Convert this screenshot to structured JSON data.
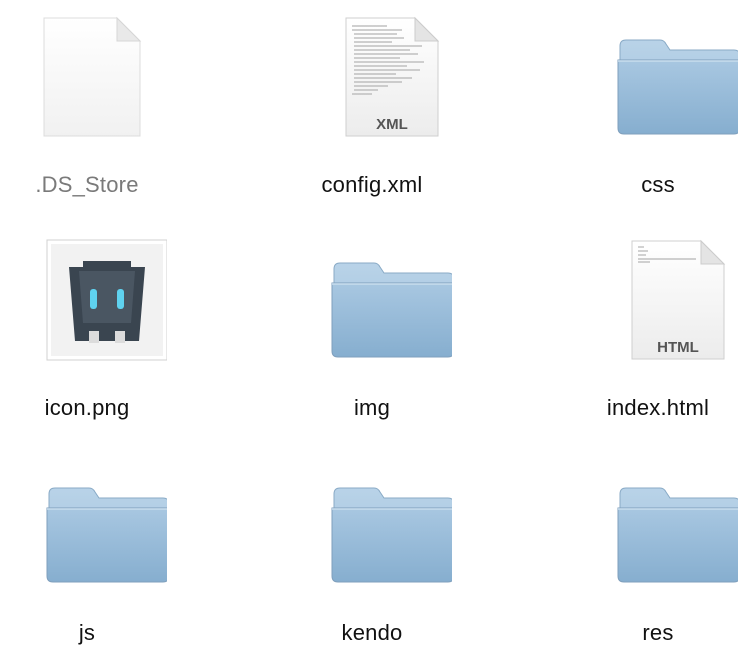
{
  "items": [
    {
      "name": ".DS_Store",
      "kind": "blank-document-icon"
    },
    {
      "name": "config.xml",
      "kind": "xml-document-icon",
      "badge": "XML"
    },
    {
      "name": "css",
      "kind": "folder-icon"
    },
    {
      "name": "icon.png",
      "kind": "cordova-robot-icon"
    },
    {
      "name": "img",
      "kind": "folder-icon"
    },
    {
      "name": "index.html",
      "kind": "html-document-icon",
      "badge": "HTML"
    },
    {
      "name": "js",
      "kind": "folder-icon"
    },
    {
      "name": "kendo",
      "kind": "folder-icon"
    },
    {
      "name": "res",
      "kind": "folder-icon"
    }
  ],
  "colors": {
    "folder_front": "#8fb6d6",
    "folder_back": "#a9c8e2",
    "label": "#111111",
    "label_hidden_file": "#7a7a7a"
  }
}
